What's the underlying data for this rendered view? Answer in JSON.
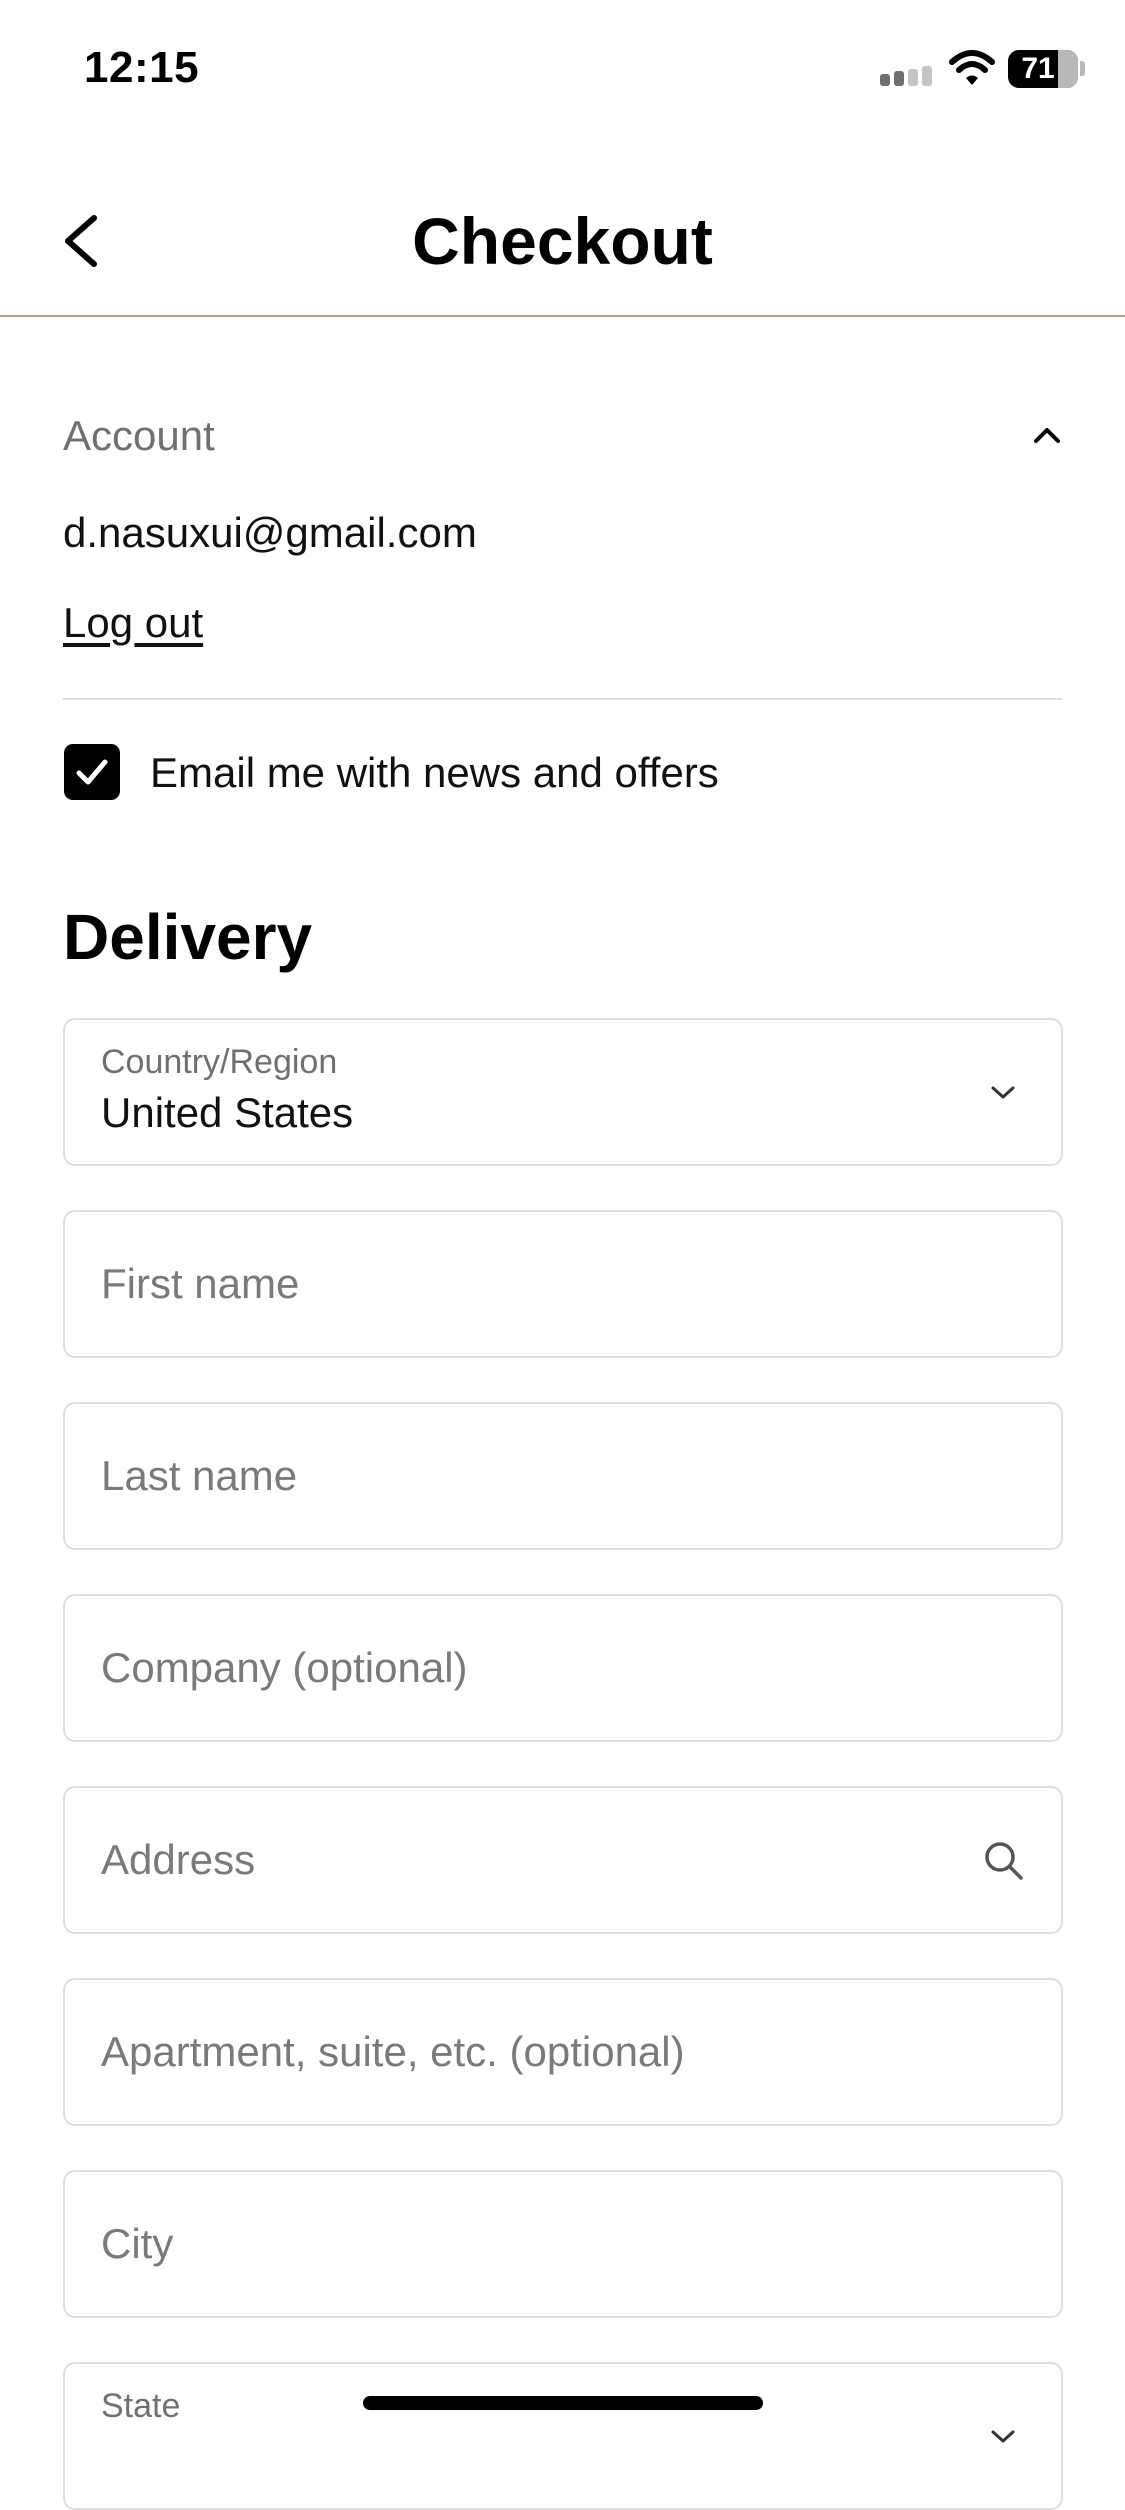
{
  "status_bar": {
    "time": "12:15",
    "battery_level": "71",
    "battery_fraction": 0.71,
    "signal_icon": "cellular-signal-icon",
    "wifi_icon": "wifi-icon"
  },
  "header": {
    "title": "Checkout",
    "back_icon": "chevron-left-icon",
    "rule_color": "#b59a8e"
  },
  "account": {
    "label": "Account",
    "email": "d.nasuxui@gmail.com",
    "logout_label": "Log out",
    "collapse_icon": "chevron-up-icon",
    "newsletter_label": "Email me with news and offers",
    "newsletter_checked": true
  },
  "delivery": {
    "title": "Delivery",
    "country": {
      "label": "Country/Region",
      "value": "United States",
      "icon": "chevron-down-icon"
    },
    "first_name_placeholder": "First name",
    "last_name_placeholder": "Last name",
    "company_placeholder": "Company (optional)",
    "address_placeholder": "Address",
    "address_icon": "search-icon",
    "apartment_placeholder": "Apartment, suite, etc. (optional)",
    "city_placeholder": "City",
    "state": {
      "label": "State",
      "icon": "chevron-down-icon"
    }
  }
}
